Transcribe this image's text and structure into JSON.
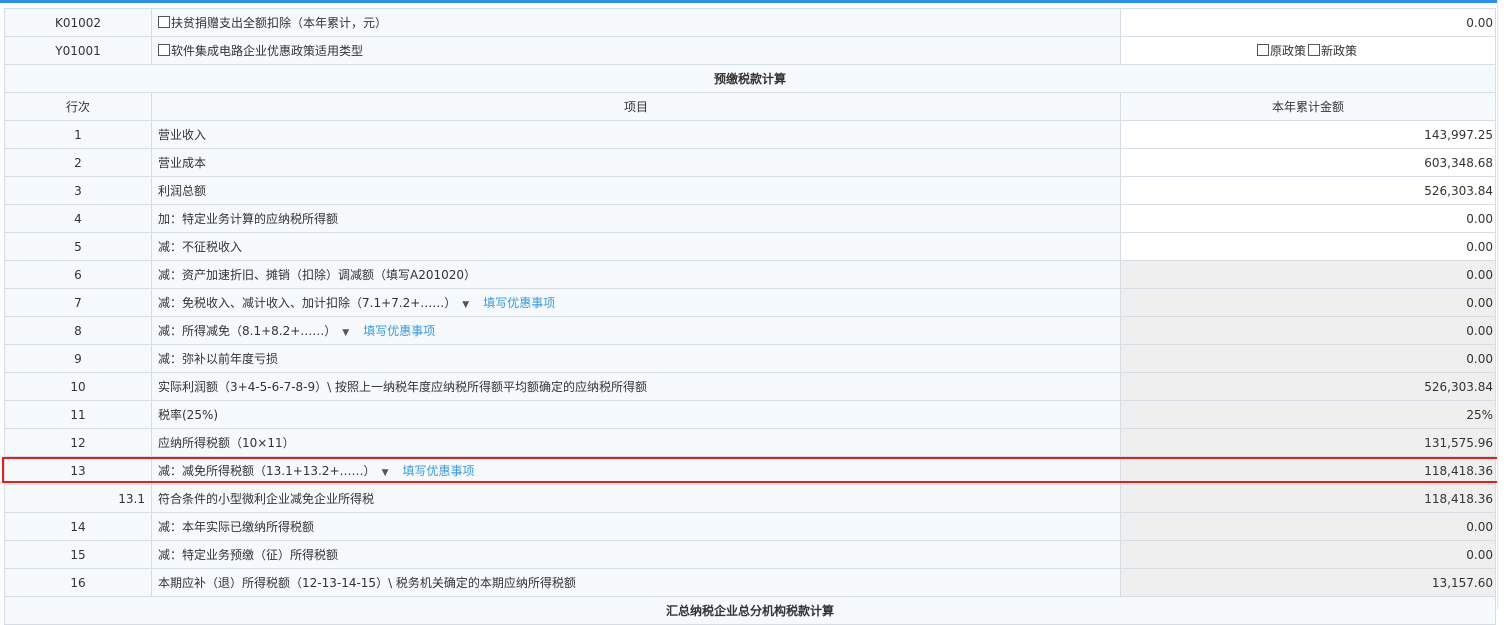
{
  "top_rows": [
    {
      "code": "K01002",
      "label": "扶贫捐赠支出全额扣除（本年累计，元）",
      "value": "0.00"
    },
    {
      "code": "Y01001",
      "label": "软件集成电路企业优惠政策适用类型",
      "options": [
        "原政策",
        "新政策"
      ]
    }
  ],
  "section_title": "预缴税款计算",
  "columns": {
    "no": "行次",
    "item": "项目",
    "amount": "本年累计金额"
  },
  "rows": [
    {
      "no": "1",
      "label": "营业收入",
      "value": "143,997.25"
    },
    {
      "no": "2",
      "label": "营业成本",
      "value": "603,348.68"
    },
    {
      "no": "3",
      "label": "利润总额",
      "value": "526,303.84"
    },
    {
      "no": "4",
      "label": "加：特定业务计算的应纳税所得额",
      "value": "0.00"
    },
    {
      "no": "5",
      "label": "减：不征税收入",
      "value": "0.00"
    },
    {
      "no": "6",
      "label": "减：资产加速折旧、摊销（扣除）调减额（填写A201020）",
      "value": "0.00"
    },
    {
      "no": "7",
      "label": "减：免税收入、减计收入、加计扣除（7.1+7.2+……）",
      "link": "填写优惠事项",
      "value": "0.00"
    },
    {
      "no": "8",
      "label": "减：所得减免（8.1+8.2+……）",
      "link": "填写优惠事项",
      "value": "0.00"
    },
    {
      "no": "9",
      "label": "减：弥补以前年度亏损",
      "value": "0.00"
    },
    {
      "no": "10",
      "label": "实际利润额（3+4-5-6-7-8-9）\\ 按照上一纳税年度应纳税所得额平均额确定的应纳税所得额",
      "value": "526,303.84"
    },
    {
      "no": "11",
      "label": "税率(25%)",
      "value": "25%"
    },
    {
      "no": "12",
      "label": "应纳所得税额（10×11）",
      "value": "131,575.96"
    },
    {
      "no": "13",
      "label": "减：减免所得税额（13.1+13.2+……）",
      "link": "填写优惠事项",
      "value": "118,418.36"
    },
    {
      "no": "13.1",
      "label": "符合条件的小型微利企业减免企业所得税",
      "value": "118,418.36"
    },
    {
      "no": "14",
      "label": "减：本年实际已缴纳所得税额",
      "value": "0.00"
    },
    {
      "no": "15",
      "label": "减：特定业务预缴（征）所得税额",
      "value": "0.00"
    },
    {
      "no": "16",
      "label": "本期应补（退）所得税额（12-13-14-15）\\ 税务机关确定的本期应纳所得税额",
      "value": "13,157.60"
    }
  ],
  "next_section_title": "汇总纳税企业总分机构税款计算",
  "colors": {
    "accent": "#2f8fe8",
    "link": "#3a9ad9",
    "highlight": "#e0201b",
    "readonly_bg": "#efeff0"
  },
  "icons": {
    "checkbox": "checkbox-icon",
    "dropdown": "caret-down-icon"
  }
}
